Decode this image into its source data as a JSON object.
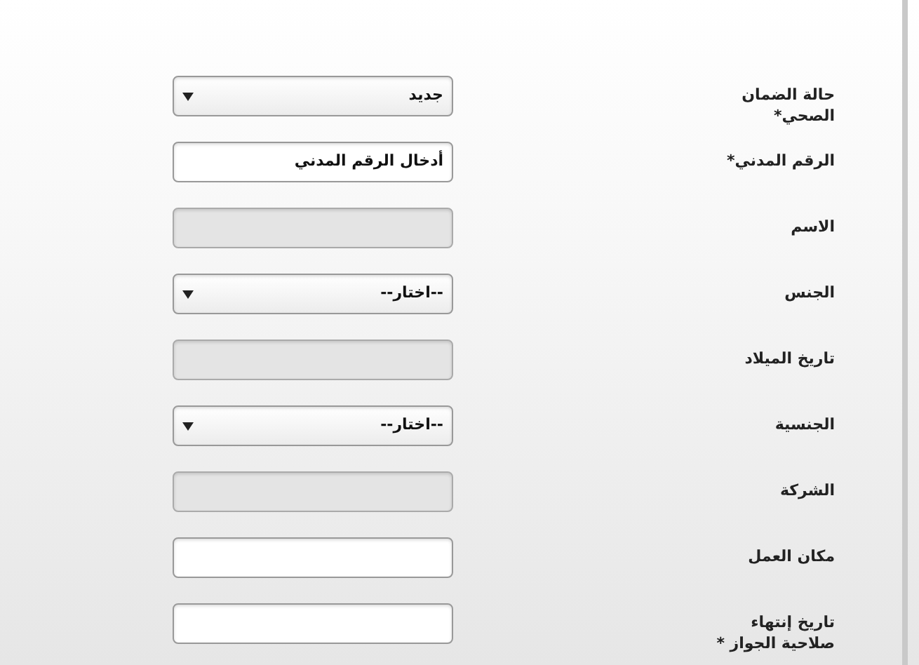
{
  "fields": [
    {
      "label": "حالة الضمان الصحي*",
      "kind": "select",
      "value": "جديد"
    },
    {
      "label": "الرقم المدني*",
      "kind": "input",
      "placeholder": "أدخال الرقم المدني",
      "disabled": false
    },
    {
      "label": "الاسم",
      "kind": "input",
      "disabled": true
    },
    {
      "label": "الجنس",
      "kind": "select",
      "value": "--اختار--"
    },
    {
      "label": "تاريخ الميلاد",
      "kind": "input",
      "disabled": true
    },
    {
      "label": "الجنسية",
      "kind": "select",
      "value": "--اختار--"
    },
    {
      "label": "الشركة",
      "kind": "input",
      "disabled": true
    },
    {
      "label": "مكان العمل",
      "kind": "input",
      "disabled": false
    },
    {
      "label": "تاريخ إنتهاء صلاحية الجواز *",
      "kind": "input",
      "disabled": false
    }
  ]
}
